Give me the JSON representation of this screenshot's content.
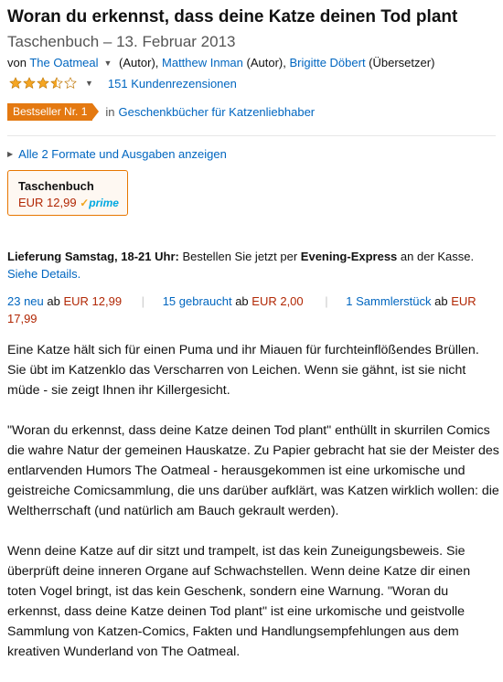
{
  "product": {
    "title": "Woran du erkennst, dass deine Katze deinen Tod plant",
    "subtitle": "Taschenbuch – 13. Februar 2013"
  },
  "byline": {
    "prefix": "von",
    "authors": [
      {
        "name": "The Oatmeal",
        "role": " (Autor), "
      },
      {
        "name": "Matthew Inman",
        "role": " (Autor), "
      },
      {
        "name": "Brigitte Döbert",
        "role": " (Übersetzer)"
      }
    ]
  },
  "rating": {
    "stars": 3.5,
    "max": 5,
    "reviews_label": "151 Kundenrezensionen",
    "star_color": "#f5a623"
  },
  "bestseller": {
    "badge": "Bestseller Nr. 1",
    "in_label": "in",
    "category": "Geschenkbücher für Katzenliebhaber",
    "badge_color": "#e47911"
  },
  "formats": {
    "link": "Alle 2 Formate und Ausgaben anzeigen",
    "selected": {
      "name": "Taschenbuch",
      "price": "EUR 12,99",
      "prime_check": "✓",
      "prime_label": "prime"
    }
  },
  "delivery": {
    "bold_label": "Lieferung Samstag, 18-21 Uhr:",
    "text_before": " Bestellen Sie jetzt per ",
    "express": "Evening-Express",
    "text_after": " an der Kasse.",
    "details_link": "Siehe Details."
  },
  "offers": [
    {
      "link": "23 neu",
      "ab": " ab ",
      "price": "EUR 12,99"
    },
    {
      "link": "15 gebraucht",
      "ab": " ab ",
      "price": "EUR 2,00"
    },
    {
      "link": "1 Sammlerstück",
      "ab": " ab ",
      "price": "EUR 17,99"
    }
  ],
  "description": [
    "Eine Katze hält sich für einen Puma und ihr Miauen für furchteinflößendes Brüllen. Sie übt im Katzenklo das Verscharren von Leichen. Wenn sie gähnt, ist sie nicht müde - sie zeigt Ihnen ihr Killergesicht.",
    "\"Woran du erkennst, dass deine Katze deinen Tod plant\" enthüllt in skurrilen Comics die wahre Natur der gemeinen Hauskatze. Zu Papier gebracht hat sie der Meister des entlarvenden Humors The Oatmeal - herausgekommen ist eine urkomische und geistreiche Comicsammlung, die uns darüber aufklärt, was Katzen wirklich wollen: die Weltherrschaft (und natürlich am Bauch gekrault werden).",
    "Wenn deine Katze auf dir sitzt und trampelt, ist das kein Zuneigungsbeweis. Sie überprüft deine inneren Organe auf Schwachstellen. Wenn deine Katze dir einen toten Vogel bringt, ist das kein Geschenk, sondern eine Warnung. \"Woran du erkennst, dass deine Katze deinen Tod plant\" ist eine urkomische und geistvolle Sammlung von Katzen-Comics, Fakten und Handlungsempfehlungen aus dem kreativen Wunderland von The Oatmeal."
  ]
}
